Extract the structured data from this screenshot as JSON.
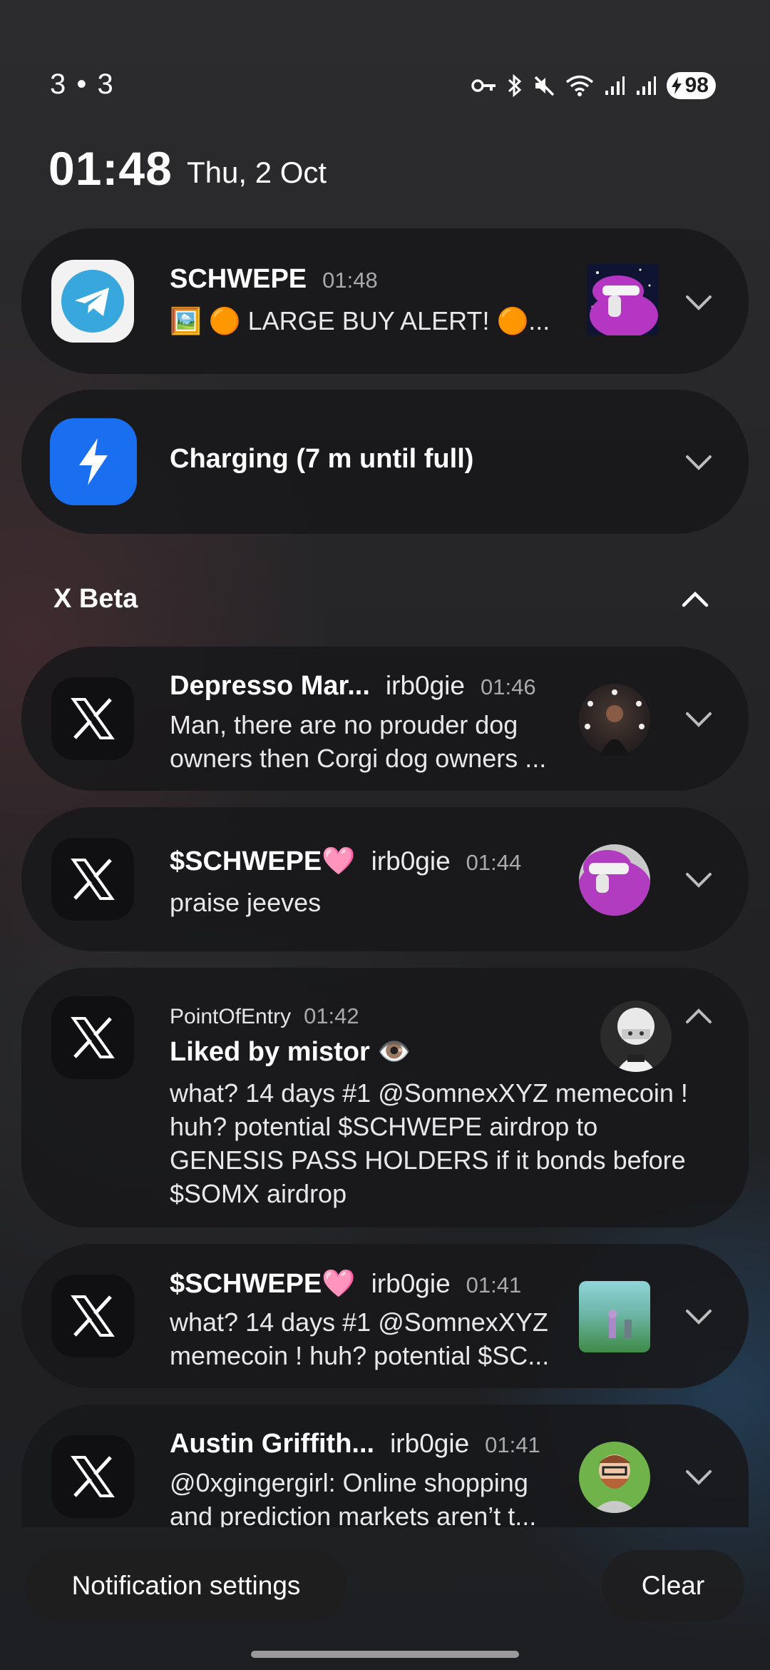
{
  "status_bar": {
    "left_text": "3 • 3",
    "icons": [
      "vpn-key-icon",
      "bluetooth-icon",
      "mute-icon",
      "wifi-icon",
      "signal-icon",
      "signal-icon"
    ],
    "battery": "98"
  },
  "header": {
    "time": "01:48",
    "date": "Thu, 2 Oct"
  },
  "notifications_top": [
    {
      "app": "Telegram",
      "title": "SCHWEPE",
      "time": "01:48",
      "body": "🖼️ 🟠 LARGE BUY ALERT! 🟠..."
    },
    {
      "app": "Charging",
      "title": "Charging (7 m until full)"
    }
  ],
  "section": {
    "label": "X Beta"
  },
  "x_notifications": [
    {
      "name": "Depresso Mar...",
      "handle": "irb0gie",
      "time": "01:46",
      "body": [
        "Man, there are no prouder dog",
        "owners then Corgi dog owners ..."
      ]
    },
    {
      "name": "$SCHWEPE🩷",
      "handle": "irb0gie",
      "time": "01:44",
      "body": [
        "praise jeeves"
      ]
    },
    {
      "source": "PointOfEntry",
      "time": "01:42",
      "title": "Liked by mistor 👁️",
      "body": [
        "what? 14 days #1 @SomnexXYZ memecoin !",
        "huh? potential $SCHWEPE airdrop to",
        "GENESIS PASS HOLDERS if it bonds before",
        "$SOMX airdrop"
      ]
    },
    {
      "name": "$SCHWEPE🩷",
      "handle": "irb0gie",
      "time": "01:41",
      "body": [
        "what? 14 days #1 @SomnexXYZ",
        "memecoin ! huh? potential $SC..."
      ]
    },
    {
      "name": "Austin Griffith...",
      "handle": "irb0gie",
      "time": "01:41",
      "body": [
        "@0xgingergirl: Online shopping",
        "and prediction markets aren’t t..."
      ]
    }
  ],
  "footer": {
    "settings_label": "Notification settings",
    "clear_label": "Clear"
  },
  "colors": {
    "telegram": "#37a7de",
    "charging": "#1a6ff0",
    "card_bg": "#18181a"
  }
}
